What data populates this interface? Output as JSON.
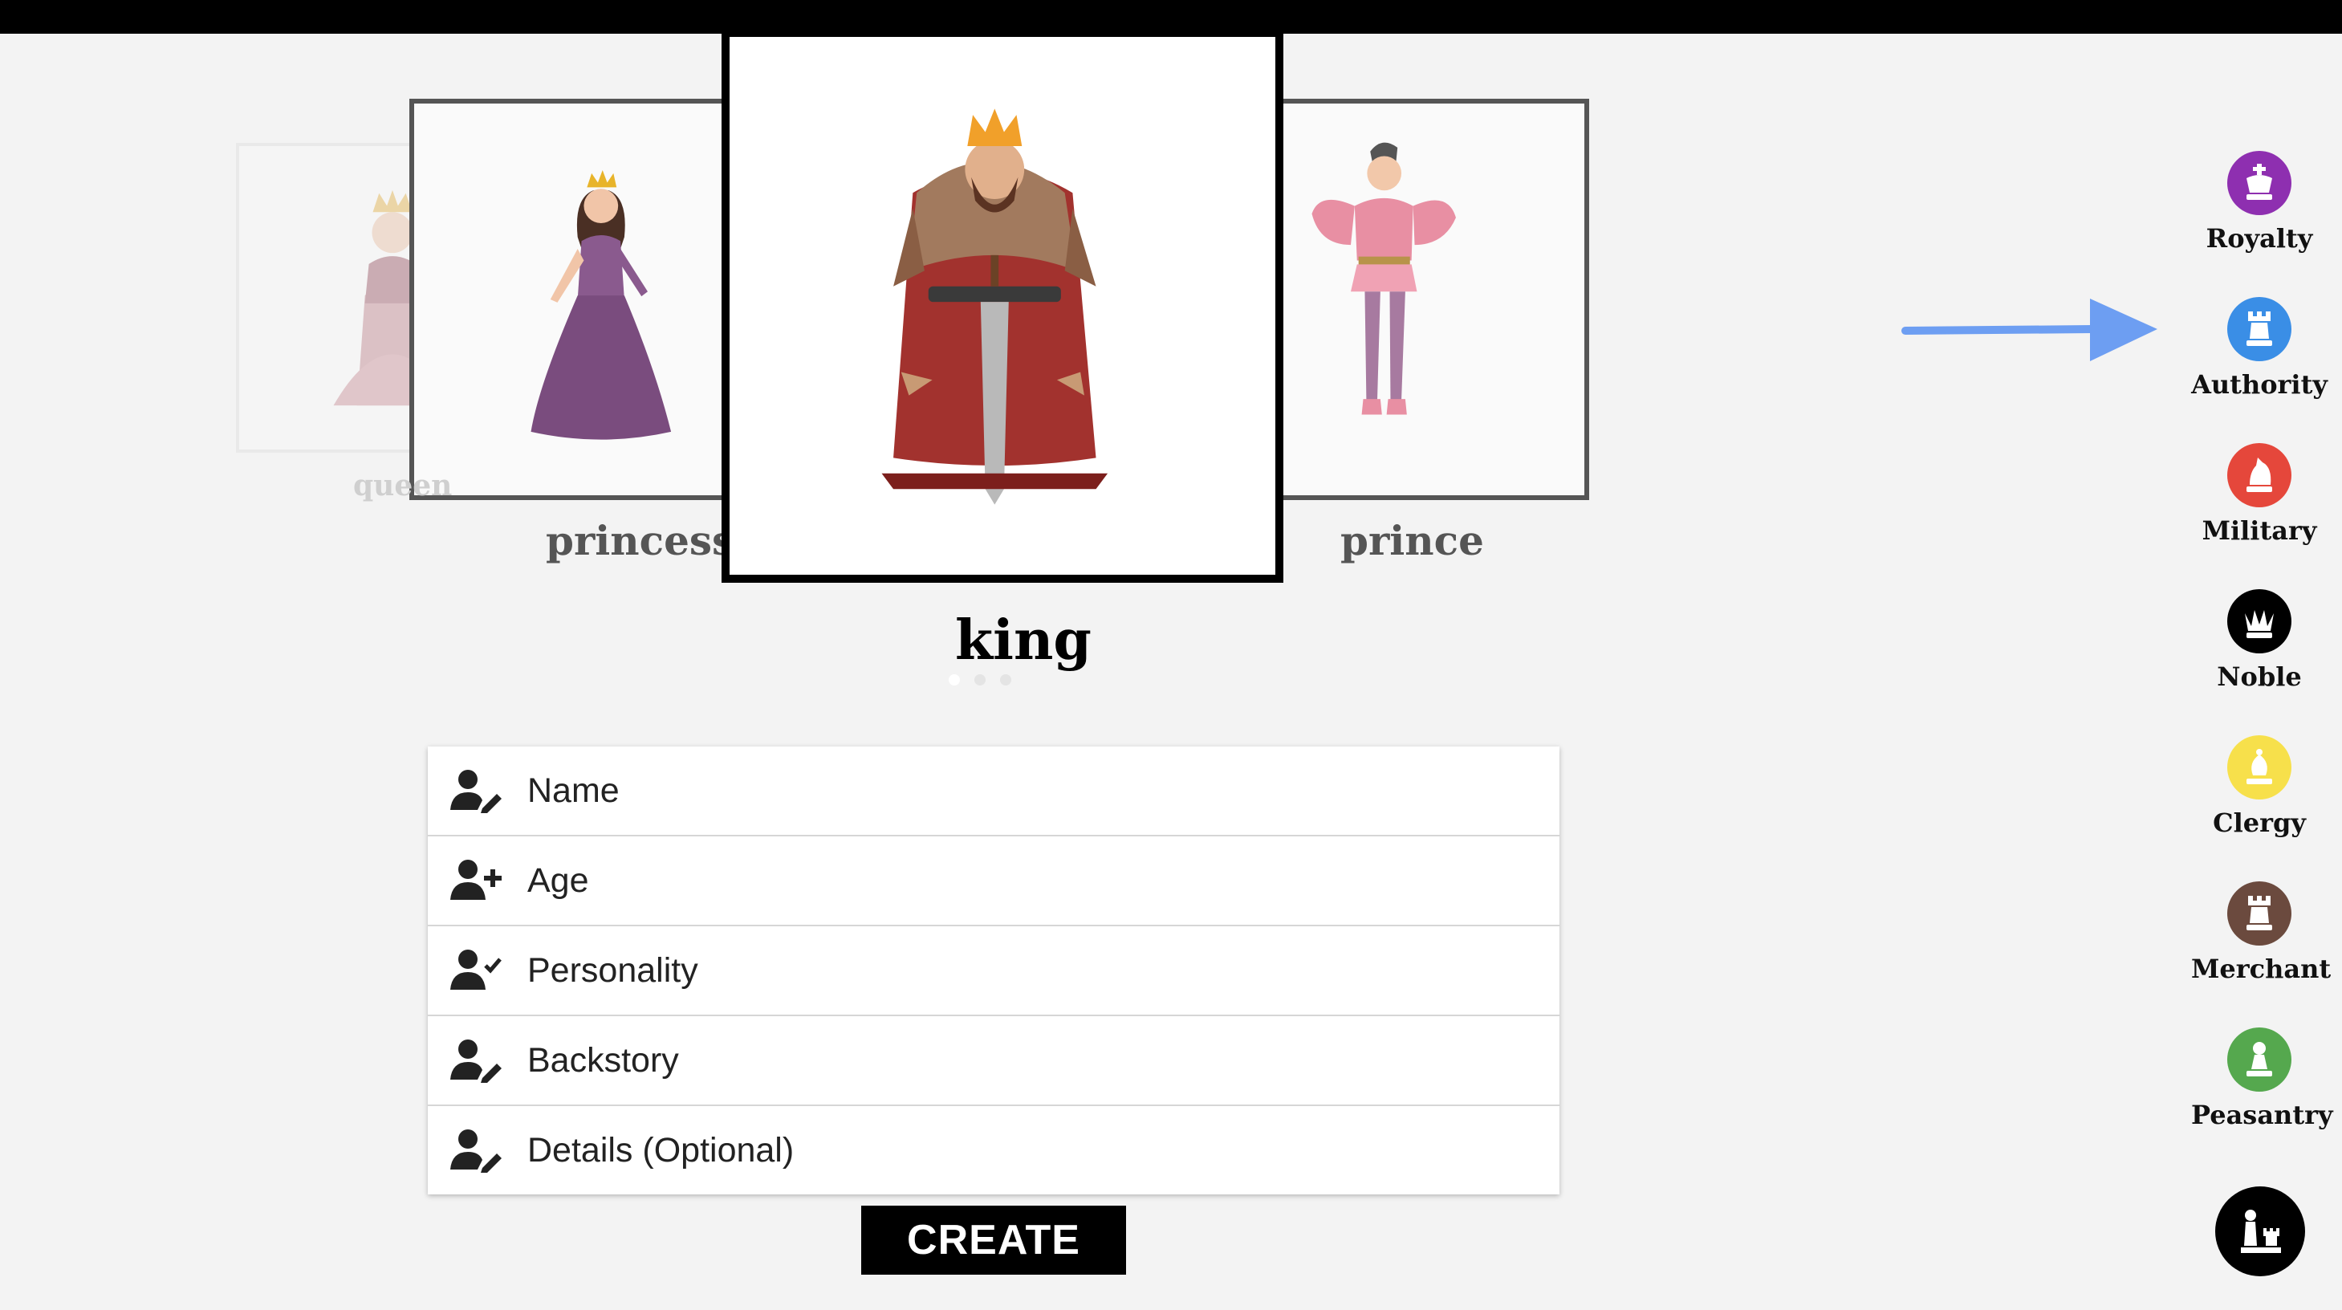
{
  "carousel": {
    "characters": [
      {
        "label": "queen"
      },
      {
        "label": "princess"
      },
      {
        "label": "king"
      },
      {
        "label": "prince"
      }
    ],
    "selected": "king",
    "dots": 3
  },
  "form": {
    "fields": [
      {
        "label": "Name",
        "icon": "user-edit-icon"
      },
      {
        "label": "Age",
        "icon": "user-plus-icon"
      },
      {
        "label": "Personality",
        "icon": "user-check-icon"
      },
      {
        "label": "Backstory",
        "icon": "user-edit-icon"
      },
      {
        "label": "Details (Optional)",
        "icon": "user-edit-icon"
      }
    ],
    "submit_label": "CREATE"
  },
  "classes": [
    {
      "label": "Royalty",
      "color": "#8e2fb0",
      "icon": "chess-king-icon"
    },
    {
      "label": "Authority",
      "color": "#3a8ee6",
      "icon": "chess-rook-icon"
    },
    {
      "label": "Military",
      "color": "#e5473b",
      "icon": "chess-knight-icon"
    },
    {
      "label": "Noble",
      "color": "#000000",
      "icon": "chess-queen-icon"
    },
    {
      "label": "Clergy",
      "color": "#f7e04b",
      "icon": "chess-bishop-icon"
    },
    {
      "label": "Merchant",
      "color": "#6b4a3e",
      "icon": "chess-rook-icon"
    },
    {
      "label": "Peasantry",
      "color": "#55a84e",
      "icon": "chess-pawn-icon"
    }
  ],
  "colors": {
    "arrow": "#6d9ef2",
    "fab": "#000000"
  },
  "fab": {
    "icon": "chess-pieces-icon"
  }
}
